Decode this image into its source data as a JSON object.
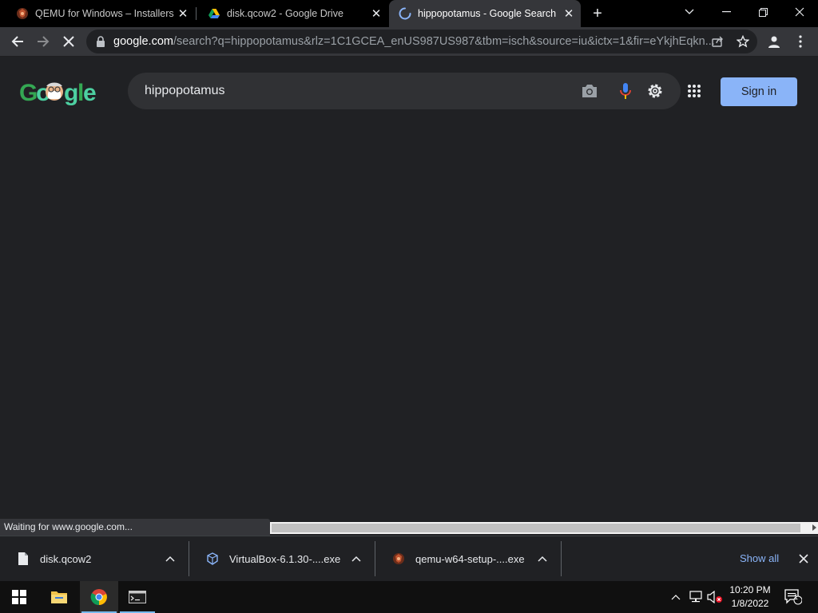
{
  "tabs": [
    {
      "title": "QEMU for Windows – Installers (",
      "icon": "qemu-icon",
      "active": false
    },
    {
      "title": "disk.qcow2 - Google Drive",
      "icon": "google-drive-icon",
      "active": false
    },
    {
      "title": "hippopotamus - Google Search",
      "icon": "loading-spinner-icon",
      "active": true
    }
  ],
  "address": {
    "host": "google.com",
    "path": "/search?q=hippopotamus&rlz=1C1GCEA_enUS987US987&tbm=isch&source=iu&ictx=1&fir=eYkjhEqkn..."
  },
  "search": {
    "query": "hippopotamus",
    "sign_in_label": "Sign in",
    "logo_text": "Google"
  },
  "status_text": "Waiting for www.google.com...",
  "downloads": [
    {
      "name": "disk.qcow2",
      "icon": "file-icon"
    },
    {
      "name": "VirtualBox-6.1.30-....exe",
      "icon": "virtualbox-icon"
    },
    {
      "name": "qemu-w64-setup-....exe",
      "icon": "qemu-icon"
    }
  ],
  "show_all_label": "Show all",
  "clock": {
    "time": "10:20 PM",
    "date": "1/8/2022"
  },
  "notification_count": "1",
  "colors": {
    "accent": "#8ab4f8",
    "page_bg": "#202124",
    "toolbar_bg": "#35363a"
  }
}
